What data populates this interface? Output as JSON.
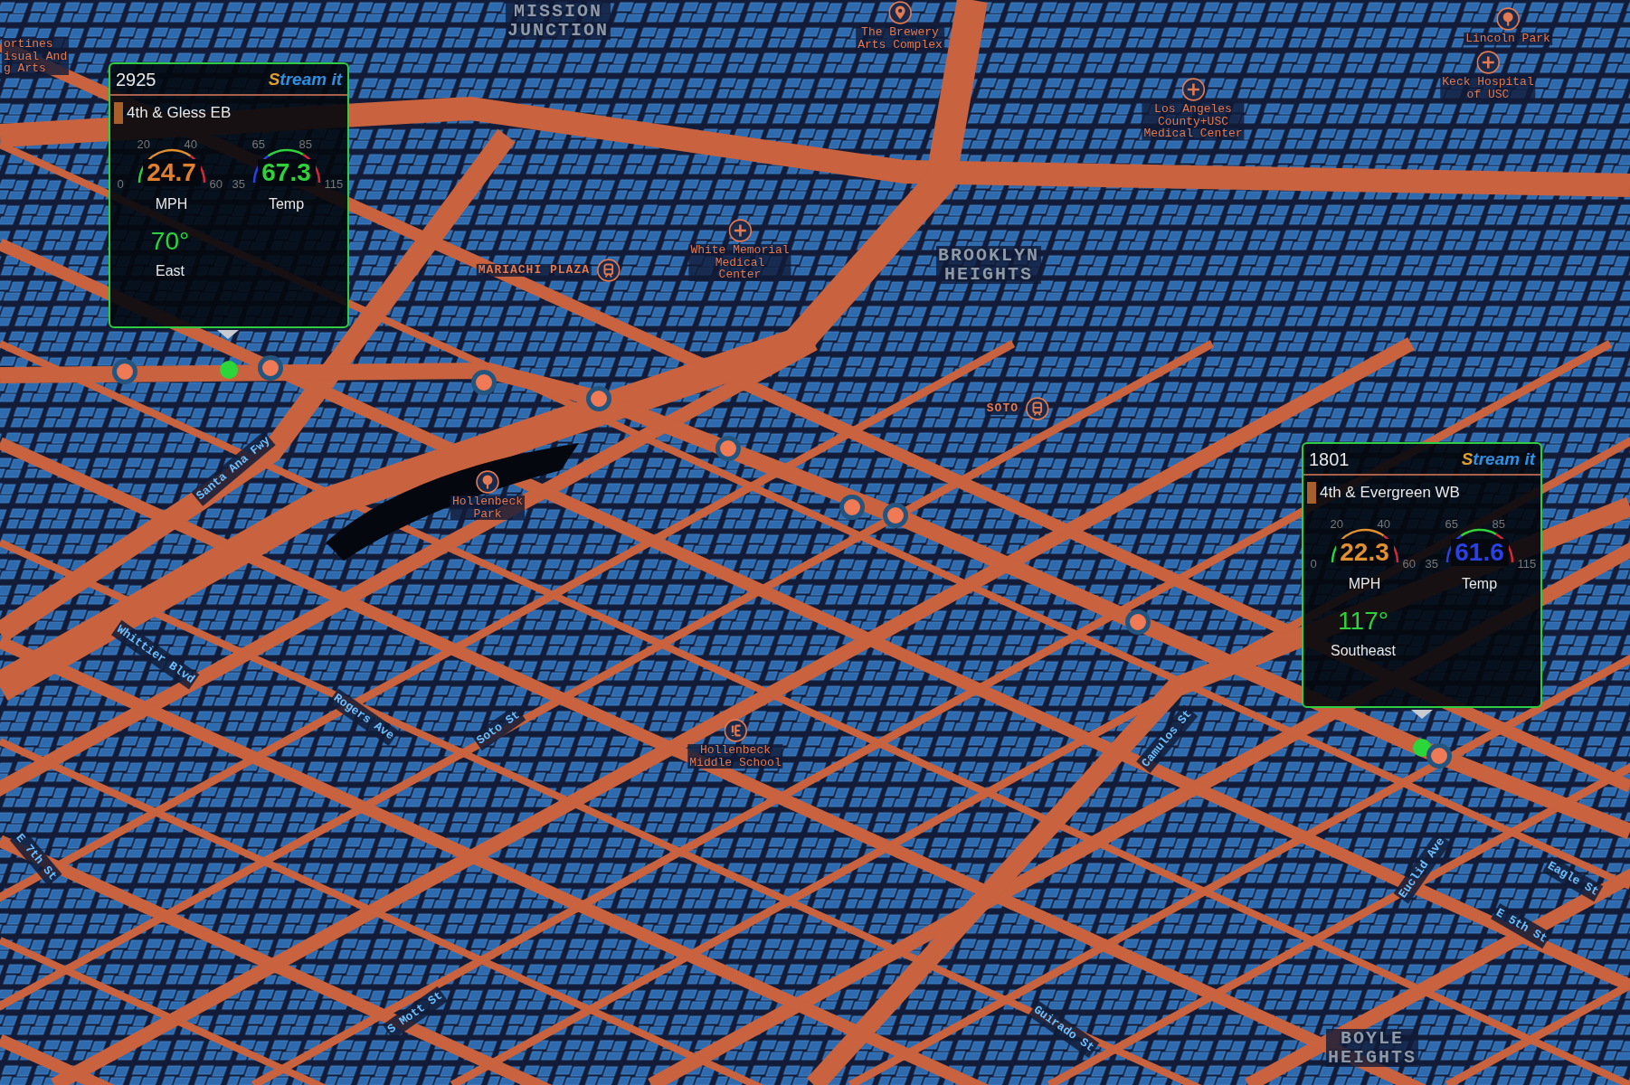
{
  "map": {
    "labels": [
      {
        "kind": "district",
        "text": "MISSION\nJUNCTION"
      },
      {
        "kind": "poi",
        "text": "The Brewery\nArts Complex"
      },
      {
        "kind": "park",
        "text": "Lincoln Park"
      },
      {
        "kind": "hospital",
        "text": "Keck Hospital\nof USC"
      },
      {
        "kind": "hospital",
        "text": "Los Angeles\nCounty+USC\nMedical Center"
      },
      {
        "kind": "station",
        "text": "MARIACHI PLAZA"
      },
      {
        "kind": "hospital",
        "text": "White Memorial\nMedical\nCenter"
      },
      {
        "kind": "district",
        "text": "BROOKLYN\nHEIGHTS"
      },
      {
        "kind": "station",
        "text": "SOTO"
      },
      {
        "kind": "park",
        "text": "Hollenbeck\nPark"
      },
      {
        "kind": "school",
        "text": "Hollenbeck\nMiddle School"
      },
      {
        "kind": "district",
        "text": "BOYLE\nHEIGHTS"
      },
      {
        "kind": "poi_text",
        "text": "ortines\nisual And\ng Arts"
      },
      {
        "kind": "street",
        "text": "Santa Ana Fwy"
      },
      {
        "kind": "street",
        "text": "Whittier Blvd"
      },
      {
        "kind": "street",
        "text": "E 7th St"
      },
      {
        "kind": "street",
        "text": "Soto St"
      },
      {
        "kind": "street",
        "text": "S Mott St"
      },
      {
        "kind": "street",
        "text": "Rogers Ave"
      },
      {
        "kind": "street",
        "text": "Euclid Ave"
      },
      {
        "kind": "street",
        "text": "Guirado St"
      },
      {
        "kind": "street",
        "text": "Camulos St"
      },
      {
        "kind": "street",
        "text": "Eagle St"
      },
      {
        "kind": "street",
        "text": "E 5th St"
      }
    ],
    "markers": [
      {
        "selected": false
      },
      {
        "selected": true
      },
      {
        "selected": false
      },
      {
        "selected": false
      },
      {
        "selected": false
      },
      {
        "selected": false
      },
      {
        "selected": false
      },
      {
        "selected": false
      },
      {
        "selected": false
      },
      {
        "selected": true
      },
      {
        "selected": false
      }
    ]
  },
  "cards": [
    {
      "id": "2925",
      "logo": "Stream it",
      "station": "4th & Gless EB",
      "gauges": [
        {
          "kind": "speed",
          "ticks": [
            "0",
            "20",
            "40",
            "60"
          ],
          "value": "24.7",
          "color": "#e0802f",
          "label": "MPH"
        },
        {
          "kind": "temp",
          "ticks": [
            "35",
            "65",
            "85",
            "115"
          ],
          "value": "67.3",
          "color": "#2fd23c",
          "label": "Temp"
        }
      ],
      "heading": "70°",
      "direction": "East"
    },
    {
      "id": "1801",
      "logo": "Stream it",
      "station": "4th & Evergreen WB",
      "gauges": [
        {
          "kind": "speed",
          "ticks": [
            "0",
            "20",
            "40",
            "60"
          ],
          "value": "22.3",
          "color": "#e0902f",
          "label": "MPH"
        },
        {
          "kind": "temp",
          "ticks": [
            "35",
            "65",
            "85",
            "115"
          ],
          "value": "61.6",
          "color": "#2a40e0",
          "label": "Temp"
        }
      ],
      "heading": "117°",
      "direction": "Southeast"
    }
  ]
}
